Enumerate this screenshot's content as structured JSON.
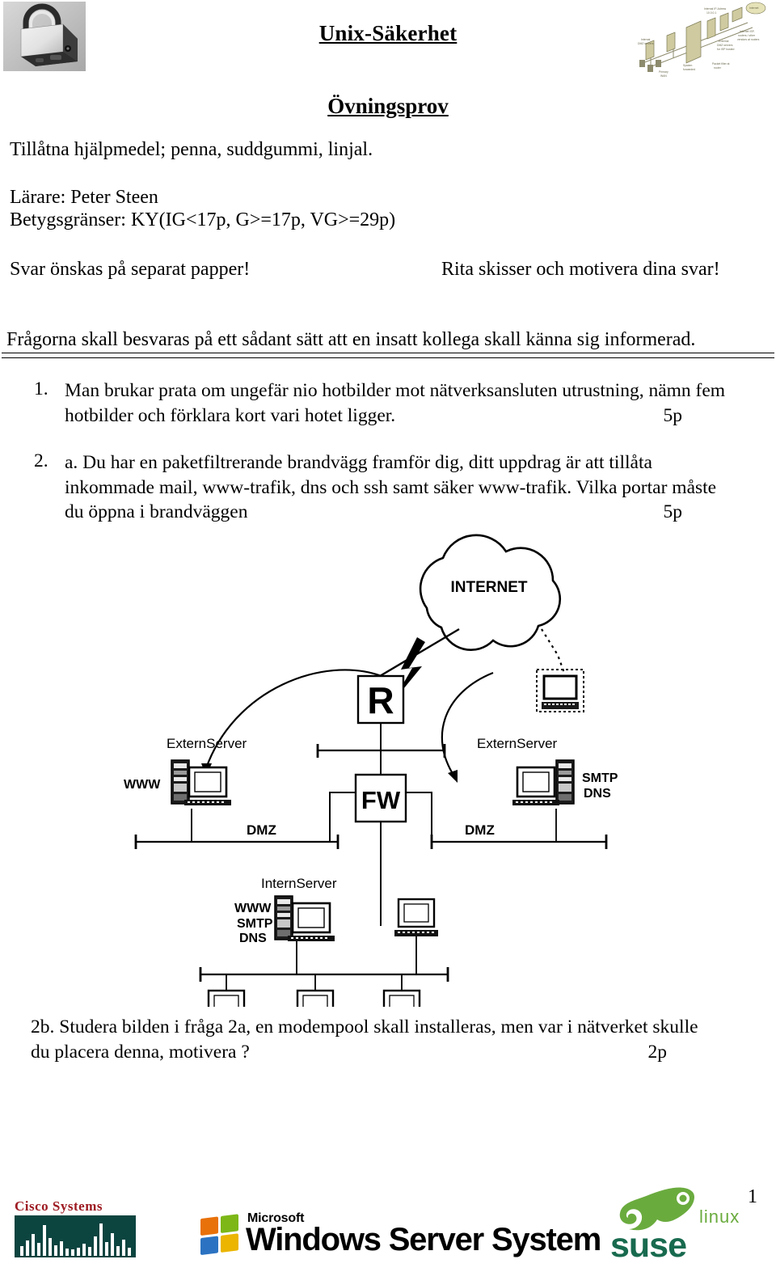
{
  "header": {
    "title": "Unix-Säkerhet",
    "subtitle": "Övningsprov",
    "padlock_icon": "padlock-photo",
    "diagram_icon": "network-topology-thumbnail"
  },
  "info": {
    "aids": "Tillåtna hjälpmedel; penna, suddgummi, linjal.",
    "teacher": "Lärare: Peter Steen",
    "grades": "Betygsgränser: KY(IG<17p, G>=17p, VG>=29p)",
    "answer_note": "Svar önskas på separat papper!",
    "sketch_note": "Rita skisser och motivera dina svar!",
    "instruction": "Frågorna skall besvaras på ett sådant sätt att en insatt kollega skall känna sig informerad."
  },
  "questions": [
    {
      "number": "1.",
      "lines": [
        "Man brukar prata om ungefär nio hotbilder mot nätverksansluten utrustning, nämn fem",
        "hotbilder och förklara kort vari hotet ligger."
      ],
      "points": "5p"
    },
    {
      "number": "2.",
      "lines": [
        "a. Du har en paketfiltrerande brandvägg framför dig, ditt uppdrag är att tillåta",
        "inkommade mail, www-trafik, dns och ssh samt säker www-trafik. Vilka portar måste",
        "du öppna i brandväggen"
      ],
      "points": "5p"
    },
    {
      "number": "2b.",
      "lines": [
        "2b. Studera bilden i fråga 2a, en modempool skall installeras, men var i nätverket skulle",
        "du placera denna, motivera ?"
      ],
      "points": "2p"
    }
  ],
  "diagram": {
    "internet_label": "INTERNET",
    "router_label": "R",
    "firewall_label": "FW",
    "extern_server_left": "ExternServer",
    "extern_server_right": "ExternServer",
    "intern_server": "InternServer",
    "www_label": "WWW",
    "smtp_dns_right": [
      "SMTP",
      "DNS"
    ],
    "intern_services": [
      "WWW",
      "SMTP",
      "DNS"
    ],
    "dmz_left": "DMZ",
    "dmz_right": "DMZ",
    "remote_host_icon": "dashed-workstation-icon"
  },
  "footer": {
    "cisco": {
      "wordmark": "Cisco Systems",
      "bg_color": "#0c4440",
      "text_color": "#9d1b22"
    },
    "microsoft": {
      "brand": "Microsoft",
      "product": "Windows Server System",
      "flag_colors": [
        "#e8710a",
        "#7cb717",
        "#2b73c2",
        "#ebb500"
      ]
    },
    "suse": {
      "wordmark": "suse",
      "linux": "linux",
      "chameleon_color": "#6aab3e",
      "word_color": "#186a4f"
    },
    "page_number": "1"
  }
}
